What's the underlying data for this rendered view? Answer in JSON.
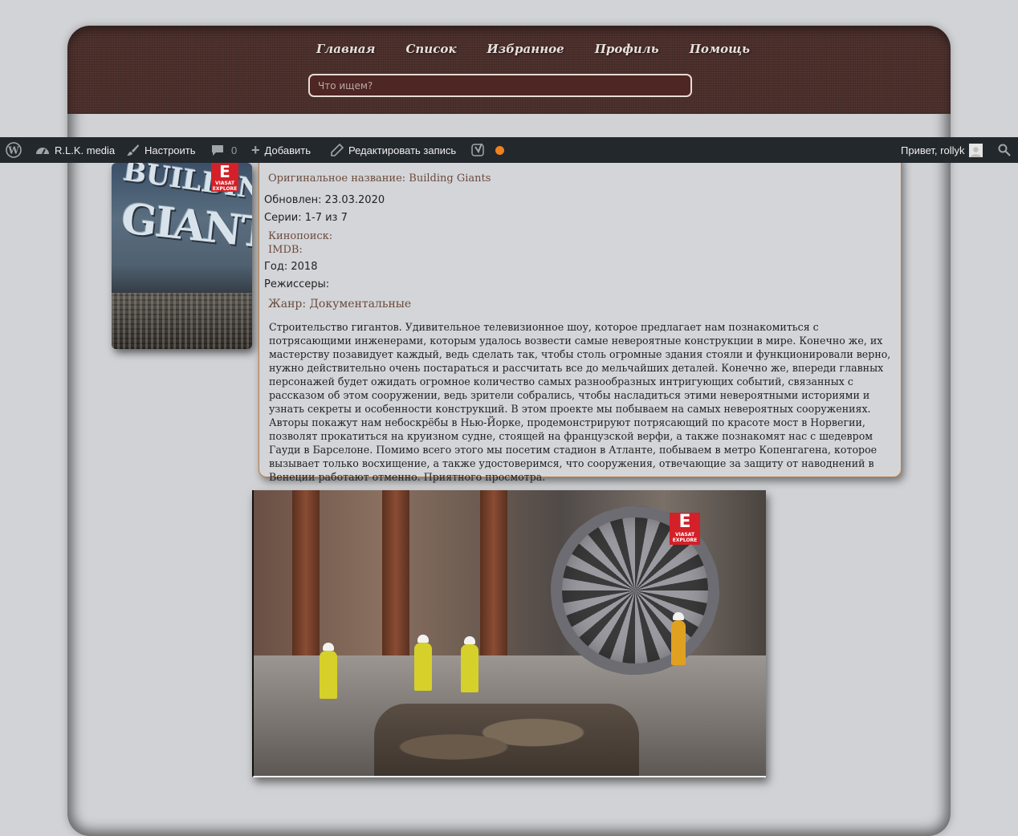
{
  "nav": {
    "items": [
      "Главная",
      "Список",
      "Избранное",
      "Профиль",
      "Помощь"
    ]
  },
  "search": {
    "placeholder": "Что ищем?"
  },
  "adminbar": {
    "site_name": "R.L.K. media",
    "customize": "Настроить",
    "comments_count": "0",
    "add_new": "Добавить",
    "edit_post": "Редактировать запись",
    "greeting": "Привет, rollyk"
  },
  "poster": {
    "title_line1": "BUILDING",
    "title_line2": "GIANTS",
    "badge_letter": "E",
    "badge_text": "VIASAT EXPLORE"
  },
  "details": {
    "original_title": "Оригинальное название: Building Giants",
    "updated": "Обновлен: 23.03.2020",
    "episodes": "Серии: 1-7 из 7",
    "kinopoisk": "Кинопоиск:",
    "imdb": "IMDB:",
    "year": "Год: 2018",
    "directors": "Режиссеры:",
    "genre": "Жанр: Документальные",
    "description": "Строительство гигантов. Удивительное телевизионное шоу, которое предлагает нам познакомиться с потрясающими инженерами, которым удалось возвести самые невероятные конструкции в мире. Конечно же, их мастерству позавидует каждый, ведь сделать так, чтобы столь огромные здания стояли и функционировали верно, нужно действительно очень постараться и рассчитать все до мельчайших деталей. Конечно же, впереди главных персонажей будет ожидать огромное количество самых разнообразных интригующих событий, связанных с рассказом об этом сооружении, ведь зрители собрались, чтобы насладиться этими невероятными историями и узнать секреты и особенности конструкций. В этом проекте мы побываем на самых невероятных сооружениях. Авторы покажут нам небоскрёбы в Нью-Йорке, продемонстрируют потрясающий по красоте мост в Норвегии, позволят прокатиться на круизном судне, стоящей на французской верфи, а также познакомят нас с шедевром Гауди в Барселоне. Помимо всего этого мы посетим стадион в Атланте, побываем в метро Копенгагена, которое вызывает только восхищение, а также удостоверимся, что сооружения, отвечающие за защиту от наводнений в Венеции работают отменно. Приятного просмотра."
  },
  "video": {
    "badge_letter": "E",
    "badge_text": "VIASAT EXPLORE"
  },
  "colors": {
    "header_bg": "#4a2e2a",
    "accent_orange": "#f0821e",
    "card_border": "#c07a3e",
    "adminbar_bg": "#23282d"
  },
  "icons": [
    "wordpress-icon",
    "dashboard-icon",
    "brush-icon",
    "comment-icon",
    "plus-icon",
    "pencil-icon",
    "yoast-icon",
    "status-dot-icon",
    "user-avatar-icon",
    "search-icon"
  ]
}
